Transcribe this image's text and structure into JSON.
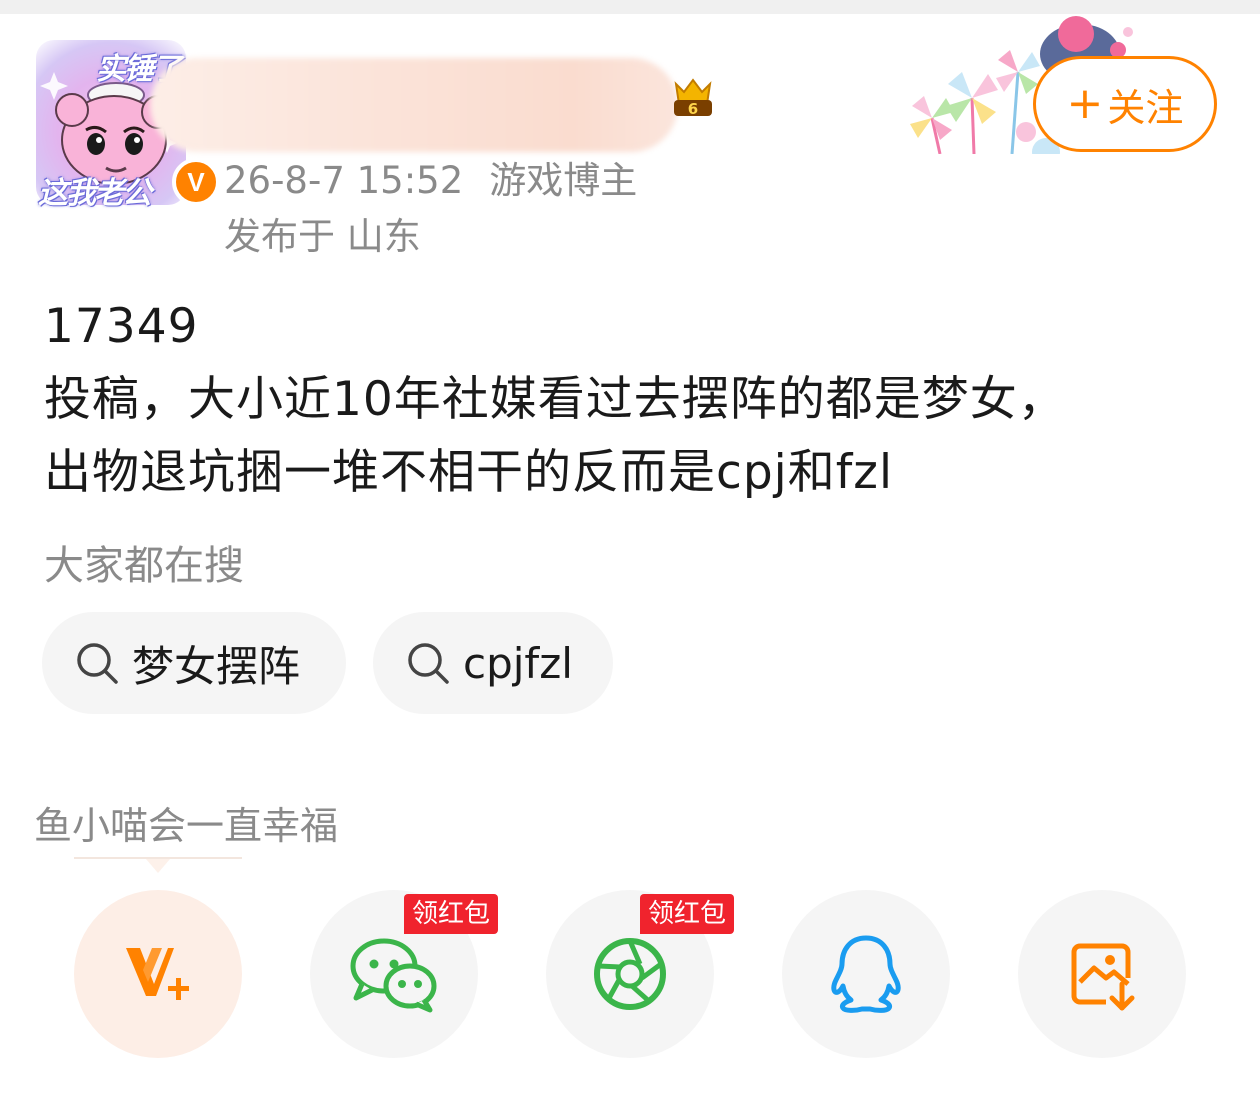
{
  "header": {
    "avatar_text_top": "实锤了",
    "avatar_text_bottom": "这我老公",
    "verified_mark": "V",
    "level_badge_text": "6",
    "post_time": "26-8-7 15:52",
    "user_tag": "游戏博主",
    "location": "发布于 山东",
    "follow_button_label": "关注",
    "follow_button_plus": "+"
  },
  "post": {
    "lines": [
      "17349",
      "投稿，大小近10年社媒看过去摆阵的都是梦女，",
      "出物退坑捆一堆不相干的反而是cpj和fzl"
    ]
  },
  "search": {
    "title": "大家都在搜",
    "chips": [
      {
        "label": "梦女摆阵",
        "icon": "search-icon"
      },
      {
        "label": "cpjfzl",
        "icon": "search-icon"
      }
    ]
  },
  "share": {
    "hint": "鱼小喵会一直幸福",
    "red_packet_label": "领红包",
    "items": [
      {
        "icon": "vplus-icon",
        "accent": "#ff8200"
      },
      {
        "icon": "wechat-icon",
        "accent": "#3bb54a"
      },
      {
        "icon": "moments-icon",
        "accent": "#3bb54a"
      },
      {
        "icon": "qq-icon",
        "accent": "#1a9cf0"
      },
      {
        "icon": "save-image-icon",
        "accent": "#ff8200"
      }
    ]
  },
  "colors": {
    "accent_orange": "#ff8200",
    "secondary_text": "#8a8a8a",
    "chip_bg": "#f5f5f5",
    "red_packet": "#f0232d"
  }
}
